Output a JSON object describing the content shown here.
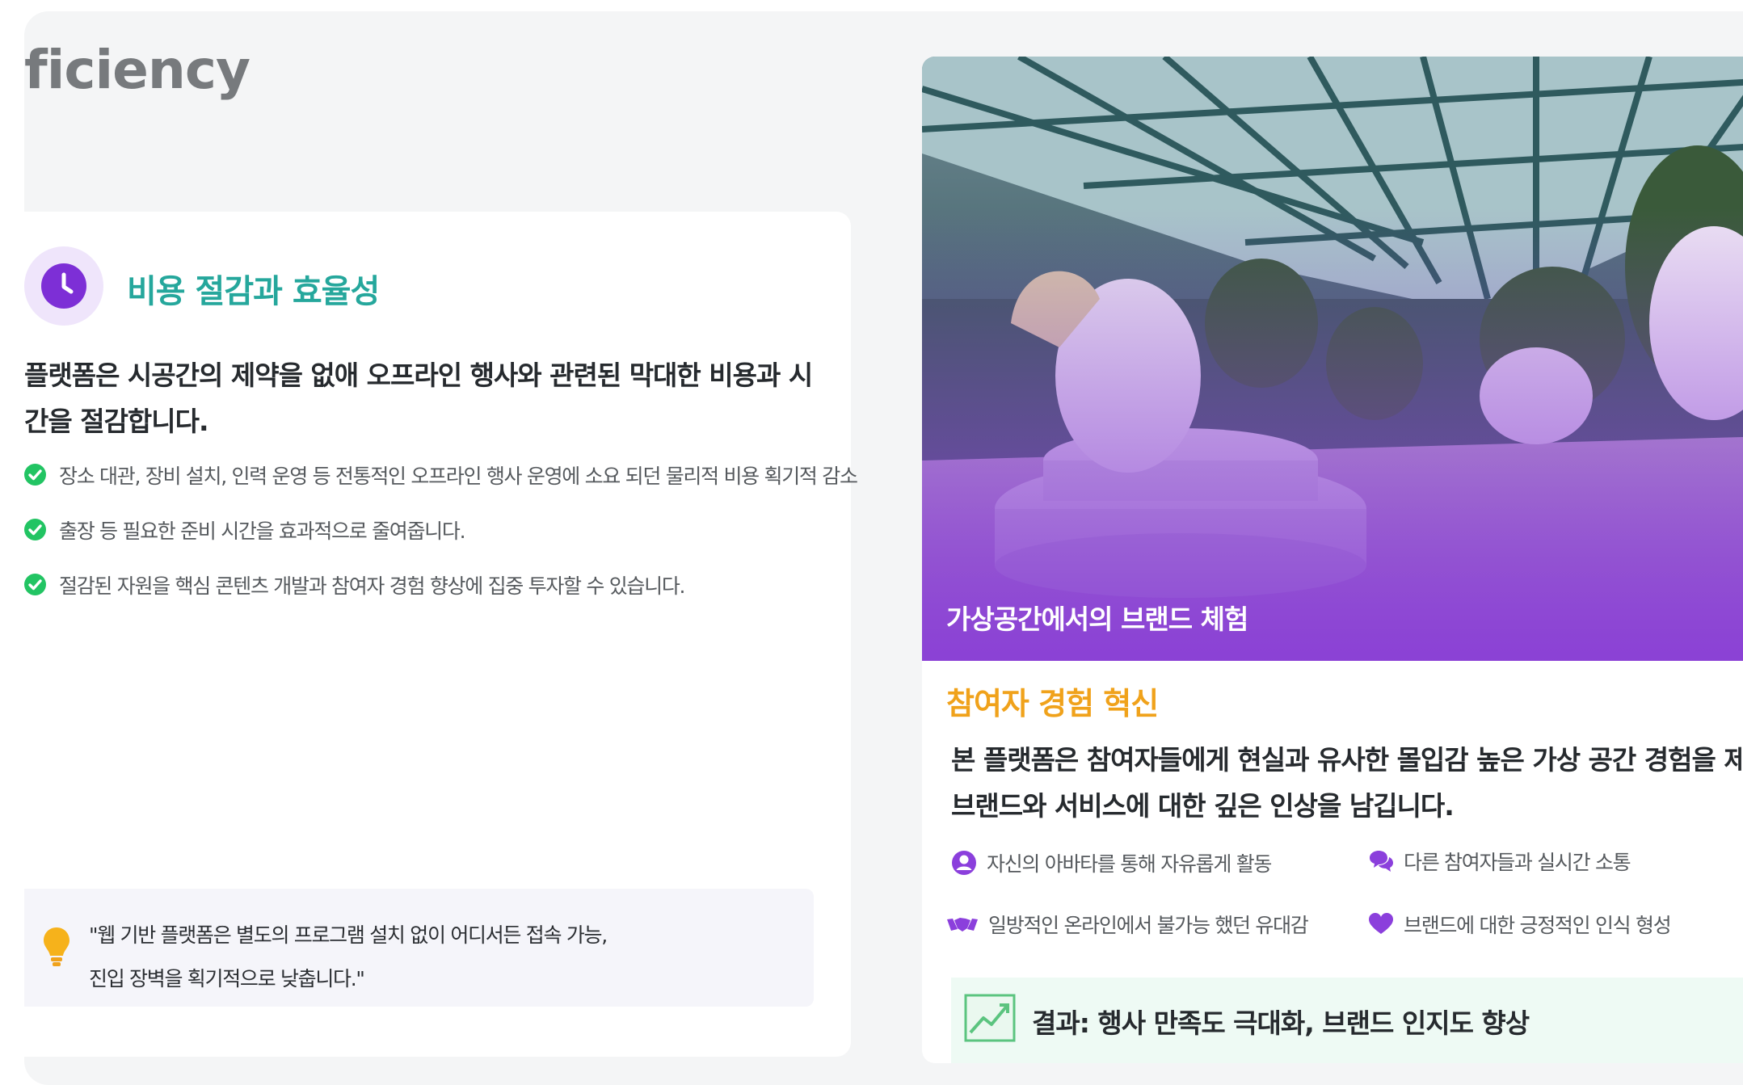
{
  "heading": "ficiency",
  "left_card": {
    "icon": "clock-icon",
    "title": "비용 절감과 효율성",
    "lead": "플랫폼은 시공간의 제약을 없애 오프라인 행사와 관련된 막대한 비용과 시간을 절감합니다.",
    "bullets": [
      {
        "icon": "check-circle-icon",
        "text": "장소 대관, 장비 설치, 인력 운영 등 전통적인 오프라인 행사 운영에 소요 되던 물리적 비용 획기적 감소"
      },
      {
        "icon": "check-circle-icon",
        "text": "출장 등 필요한 준비 시간을 효과적으로 줄여줍니다."
      },
      {
        "icon": "check-circle-icon",
        "text": "절감된 자원을 핵심 콘텐츠 개발과 참여자 경험 향상에 집중 투자할 수 있습니다."
      }
    ],
    "quote": {
      "icon": "lightbulb-icon",
      "line1": "\"웹 기반 플랫폼은 별도의 프로그램 설치 없이 어디서든 접속 가능,",
      "line2": "진입 장벽을 획기적으로 낮춥니다.\""
    }
  },
  "right_card": {
    "photo_caption": "가상공간에서의 브랜드 체험",
    "title": "참여자 경험 혁신",
    "description_line1": "본 플랫폼은 참여자들에게 현실과 유사한 몰입감 높은 가상 공간 경험을 제공하",
    "description_line2": "브랜드와 서비스에 대한 깊은 인상을 남깁니다.",
    "features": [
      {
        "icon": "user-circle-icon",
        "text": "자신의 아바타를 통해 자유롭게 활동"
      },
      {
        "icon": "chat-bubbles-icon",
        "text": "다른 참여자들과 실시간 소통"
      },
      {
        "icon": "handshake-icon",
        "text": "일방적인 온라인에서 불가능 했던 유대감"
      },
      {
        "icon": "heart-icon",
        "text": "브랜드에 대한 긍정적인 인식 형성"
      }
    ],
    "result": {
      "icon": "trending-up-icon",
      "text": "결과: 행사 만족도 극대화, 브랜드 인지도 향상"
    }
  },
  "colors": {
    "teal": "#25a79c",
    "purple": "#7d2fd6",
    "orange": "#f0a21b",
    "green": "#22c463"
  }
}
